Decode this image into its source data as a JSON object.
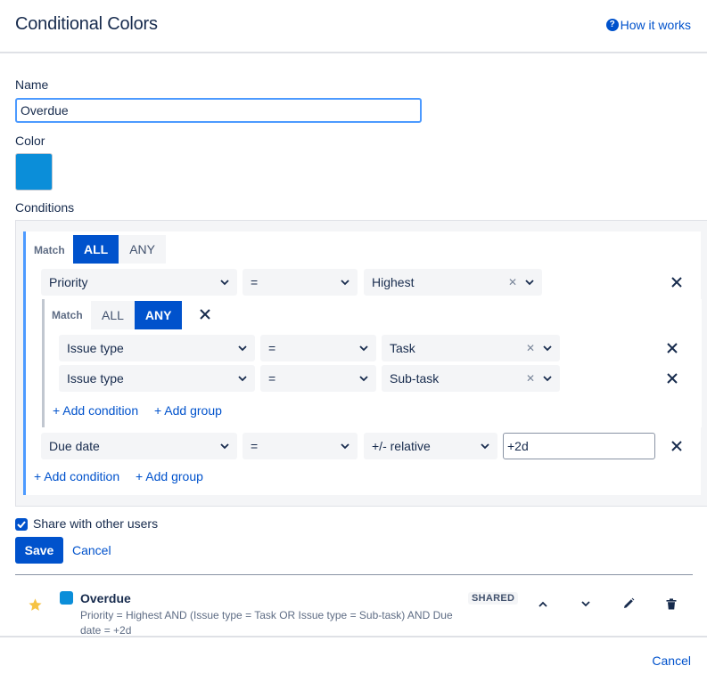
{
  "header": {
    "title": "Conditional Colors",
    "help_link": "How it works",
    "help_icon": "question-circle-icon"
  },
  "form": {
    "name_label": "Name",
    "name_value": "Overdue",
    "color_label": "Color",
    "color_value": "#0b8ed9",
    "conditions_label": "Conditions"
  },
  "outer_group": {
    "match_label": "Match",
    "options": [
      "ALL",
      "ANY"
    ],
    "selected": "ALL",
    "row1": {
      "field": "Priority",
      "operator": "=",
      "value": "Highest"
    },
    "row2": {
      "field": "Due date",
      "operator": "=",
      "value": "+/- relative",
      "input": "+2d"
    },
    "add_condition": "+ Add condition",
    "add_group": "+ Add group"
  },
  "inner_group": {
    "match_label": "Match",
    "options": [
      "ALL",
      "ANY"
    ],
    "selected": "ANY",
    "row1": {
      "field": "Issue type",
      "operator": "=",
      "value": "Task"
    },
    "row2": {
      "field": "Issue type",
      "operator": "=",
      "value": "Sub-task"
    },
    "add_condition": "+ Add condition",
    "add_group": "+ Add group"
  },
  "share": {
    "label": "Share with other users",
    "checked": true
  },
  "actions": {
    "save": "Save",
    "cancel": "Cancel"
  },
  "list": [
    {
      "name": "Overdue",
      "description": "Priority = Highest AND (Issue type = Task OR Issue type = Sub-task) AND Due date = +2d",
      "badge": "SHARED",
      "color": "#0b8ed9",
      "favorite": true
    }
  ],
  "footer": {
    "cancel": "Cancel"
  },
  "colors": {
    "accent": "#0052cc",
    "star": "#f6c343"
  }
}
